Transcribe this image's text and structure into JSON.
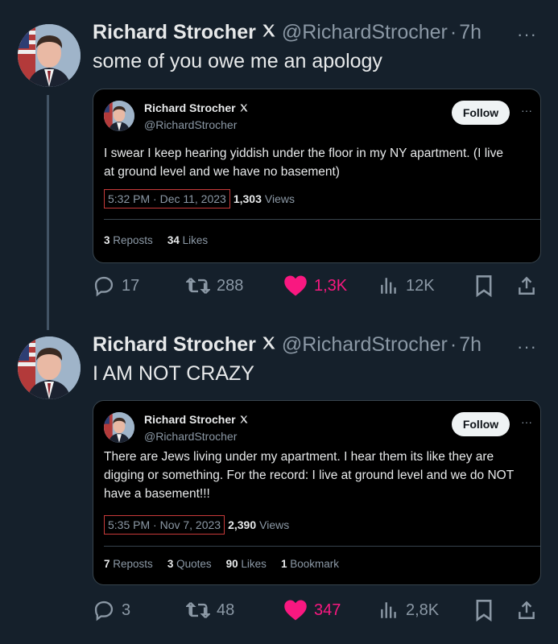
{
  "posts": [
    {
      "author": {
        "name": "Richard Strocher",
        "handle": "@RichardStrocher",
        "time": "7h"
      },
      "text": "some of you owe me an apology",
      "quote": {
        "name": "Richard Strocher",
        "handle": "@RichardStrocher",
        "follow_label": "Follow",
        "lines": [
          "I swear I keep hearing yiddish under the floor in my NY apartment. (I live",
          "at ground level and we have no basement)"
        ],
        "timestamp": "5:32 PM · Dec 11, 2023",
        "views_count": "1,303",
        "views_label": "Views",
        "stats": [
          {
            "num": "3",
            "label": "Reposts"
          },
          {
            "num": "34",
            "label": "Likes"
          }
        ]
      },
      "actions": {
        "replies": "17",
        "reposts": "288",
        "likes": "1,3K",
        "views": "12K"
      }
    },
    {
      "author": {
        "name": "Richard Strocher",
        "handle": "@RichardStrocher",
        "time": "7h"
      },
      "text": "I AM NOT CRAZY",
      "quote": {
        "name": "Richard Strocher",
        "handle": "@RichardStrocher",
        "follow_label": "Follow",
        "lines": [
          "There are Jews living under my apartment. I hear them its like they are",
          "digging or something. For the record: I live at ground level and we do NOT",
          "have a basement!!!"
        ],
        "timestamp": "5:35 PM · Nov 7, 2023",
        "views_count": "2,390",
        "views_label": "Views",
        "stats": [
          {
            "num": "7",
            "label": "Reposts"
          },
          {
            "num": "3",
            "label": "Quotes"
          },
          {
            "num": "90",
            "label": "Likes"
          },
          {
            "num": "1",
            "label": "Bookmark"
          }
        ]
      },
      "actions": {
        "replies": "3",
        "reposts": "48",
        "likes": "347",
        "views": "2,8K"
      }
    }
  ],
  "ui": {
    "dot": "·",
    "more": "···"
  },
  "colors": {
    "background": "#15202b",
    "like": "#f91880",
    "muted": "#8b98a5",
    "timestamp_box": "#c73a3a"
  }
}
